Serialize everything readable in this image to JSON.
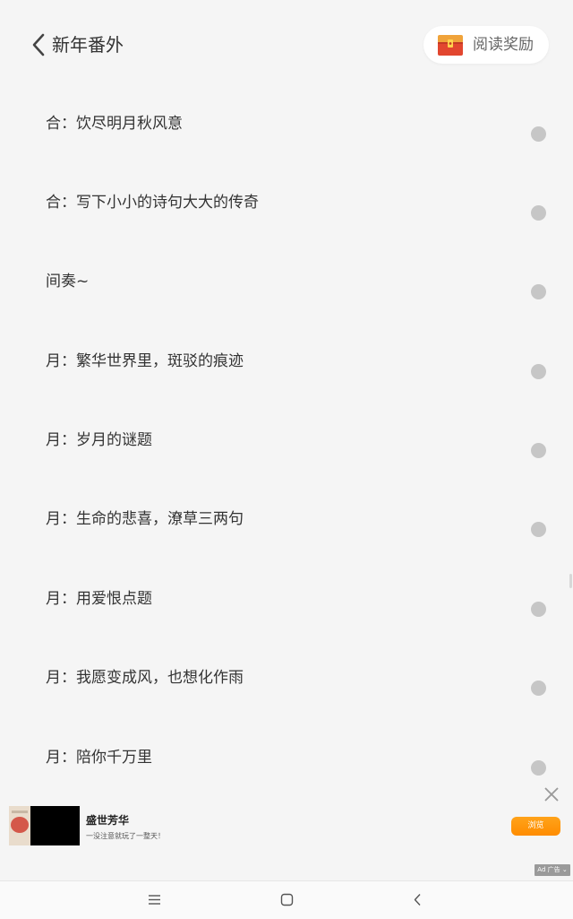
{
  "header": {
    "title": "新年番外",
    "back_icon": "chevron-left-icon",
    "reward": {
      "label": "阅读奖励",
      "icon": "treasure-chest-icon"
    }
  },
  "lines": [
    {
      "text": "合：饮尽明月秋风意"
    },
    {
      "text": "合：写下小小的诗句大大的传奇"
    },
    {
      "text": "间奏~"
    },
    {
      "text": "月：繁华世界里，斑驳的痕迹"
    },
    {
      "text": "月：岁月的谜题"
    },
    {
      "text": "月：生命的悲喜，潦草三两句"
    },
    {
      "text": "月：用爱恨点题"
    },
    {
      "text": "月：我愿变成风，也想化作雨"
    },
    {
      "text": "月：陪你千万里"
    }
  ],
  "ad": {
    "title": "盛世芳华",
    "description": "一没注意就玩了一整天！",
    "button": "浏览",
    "badge": "Ad 广告 ⌄",
    "close_icon": "close-icon"
  },
  "colors": {
    "background": "#f5f5f5",
    "text": "#333333",
    "dot": "#c6c6c6",
    "ad_button": "#ff9a0f"
  }
}
